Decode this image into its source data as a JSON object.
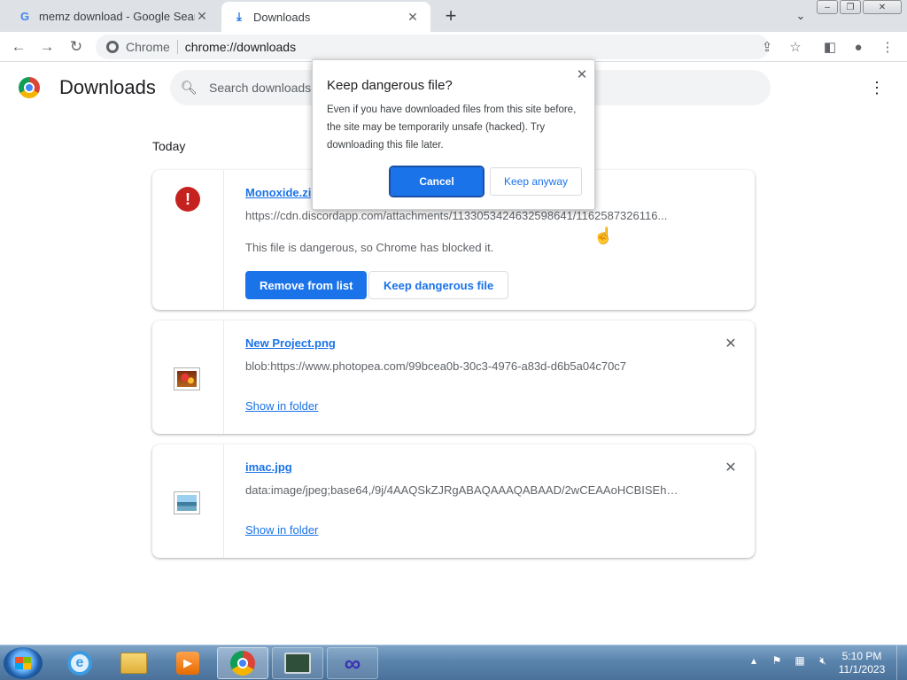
{
  "tabs": [
    {
      "title": "memz download - Google Search",
      "favicon": "G",
      "active": false
    },
    {
      "title": "Downloads",
      "favicon": "download-icon",
      "active": true
    }
  ],
  "toolbar": {
    "chip_label": "Chrome",
    "url": "chrome://downloads"
  },
  "page": {
    "title": "Downloads",
    "search_placeholder": "Search downloads",
    "section_date": "Today"
  },
  "downloads": [
    {
      "filename": "Monoxide.zip",
      "url": "https://cdn.discordapp.com/attachments/1133053424632598641/1162587326116...",
      "status": "This file is dangerous, so Chrome has blocked it.",
      "primary_action": "Remove from list",
      "secondary_action": "Keep dangerous file",
      "icon": "danger-icon"
    },
    {
      "filename": "New Project.png",
      "url": "blob:https://www.photopea.com/99bcea0b-30c3-4976-a83d-d6b5a04c70c7",
      "action": "Show in folder",
      "icon": "image-thumbnail"
    },
    {
      "filename": "imac.jpg",
      "url": "data:image/jpeg;base64,/9j/4AAQSkZJRgABAQAAAQABAAD/2wCEAAoHCBISEhESE...",
      "action": "Show in folder",
      "icon": "image-thumbnail"
    }
  ],
  "dialog": {
    "title": "Keep dangerous file?",
    "body": "Even if you have downloaded files from this site before, the site may be temporarily unsafe (hacked). Try downloading this file later.",
    "cancel_label": "Cancel",
    "keep_label": "Keep anyway"
  },
  "taskbar": {
    "time": "5:10 PM",
    "date": "11/1/2023"
  },
  "colors": {
    "accent": "#1a73e8",
    "danger": "#c5221f",
    "tabstrip": "#dee1e6"
  }
}
